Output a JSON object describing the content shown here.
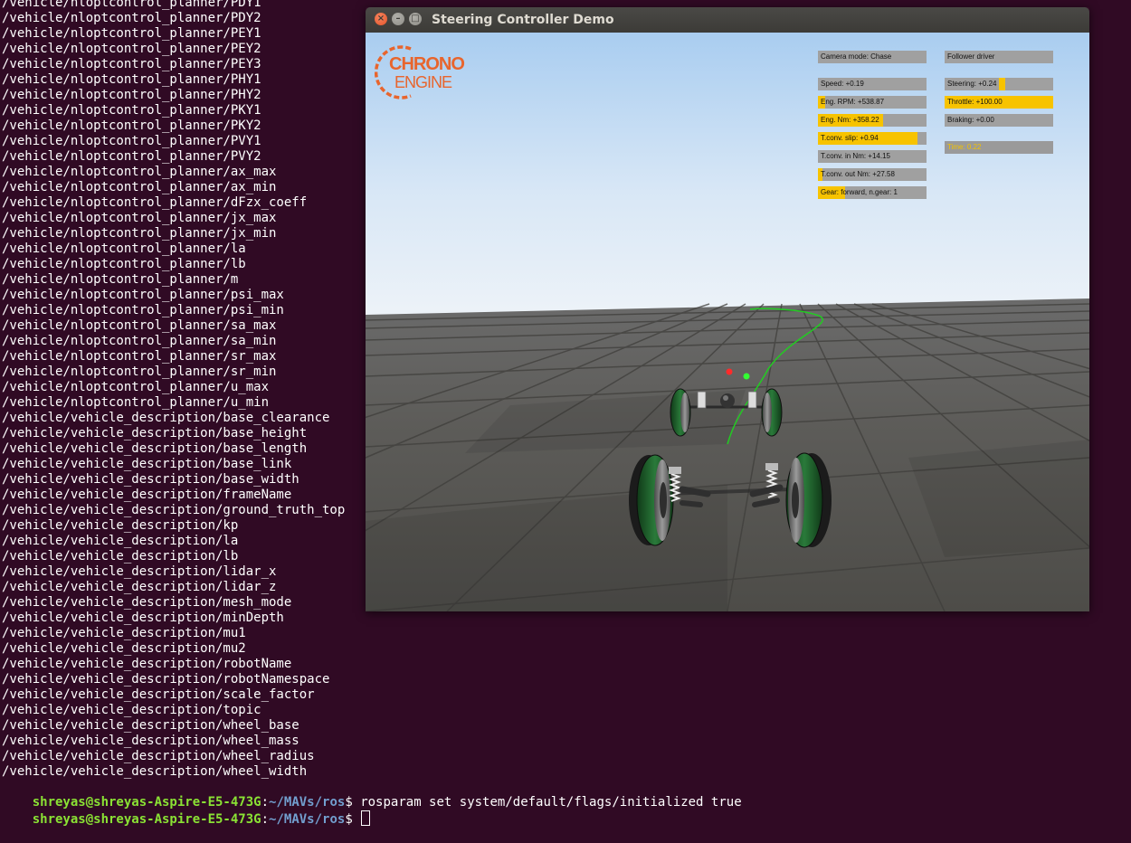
{
  "terminal": {
    "lines": [
      "/vehicle/nloptcontrol_planner/PDY1",
      "/vehicle/nloptcontrol_planner/PDY2",
      "/vehicle/nloptcontrol_planner/PEY1",
      "/vehicle/nloptcontrol_planner/PEY2",
      "/vehicle/nloptcontrol_planner/PEY3",
      "/vehicle/nloptcontrol_planner/PHY1",
      "/vehicle/nloptcontrol_planner/PHY2",
      "/vehicle/nloptcontrol_planner/PKY1",
      "/vehicle/nloptcontrol_planner/PKY2",
      "/vehicle/nloptcontrol_planner/PVY1",
      "/vehicle/nloptcontrol_planner/PVY2",
      "/vehicle/nloptcontrol_planner/ax_max",
      "/vehicle/nloptcontrol_planner/ax_min",
      "/vehicle/nloptcontrol_planner/dFzx_coeff",
      "/vehicle/nloptcontrol_planner/jx_max",
      "/vehicle/nloptcontrol_planner/jx_min",
      "/vehicle/nloptcontrol_planner/la",
      "/vehicle/nloptcontrol_planner/lb",
      "/vehicle/nloptcontrol_planner/m",
      "/vehicle/nloptcontrol_planner/psi_max",
      "/vehicle/nloptcontrol_planner/psi_min",
      "/vehicle/nloptcontrol_planner/sa_max",
      "/vehicle/nloptcontrol_planner/sa_min",
      "/vehicle/nloptcontrol_planner/sr_max",
      "/vehicle/nloptcontrol_planner/sr_min",
      "/vehicle/nloptcontrol_planner/u_max",
      "/vehicle/nloptcontrol_planner/u_min",
      "/vehicle/vehicle_description/base_clearance",
      "/vehicle/vehicle_description/base_height",
      "/vehicle/vehicle_description/base_length",
      "/vehicle/vehicle_description/base_link",
      "/vehicle/vehicle_description/base_width",
      "/vehicle/vehicle_description/frameName",
      "/vehicle/vehicle_description/ground_truth_top",
      "/vehicle/vehicle_description/kp",
      "/vehicle/vehicle_description/la",
      "/vehicle/vehicle_description/lb",
      "/vehicle/vehicle_description/lidar_x",
      "/vehicle/vehicle_description/lidar_z",
      "/vehicle/vehicle_description/mesh_mode",
      "/vehicle/vehicle_description/minDepth",
      "/vehicle/vehicle_description/mu1",
      "/vehicle/vehicle_description/mu2",
      "/vehicle/vehicle_description/robotName",
      "/vehicle/vehicle_description/robotNamespace",
      "/vehicle/vehicle_description/scale_factor",
      "/vehicle/vehicle_description/topic",
      "/vehicle/vehicle_description/wheel_base",
      "/vehicle/vehicle_description/wheel_mass",
      "/vehicle/vehicle_description/wheel_radius",
      "/vehicle/vehicle_description/wheel_width"
    ],
    "prompt_user": "shreyas@shreyas-Aspire-E5-473G",
    "prompt_path": "~/MAVs/ros",
    "prompt_symbol": "$ ",
    "last_command": "rosparam set system/default/flags/initialized true",
    "current_input": ""
  },
  "window": {
    "title": "Steering Controller Demo",
    "close_glyph": "×",
    "minimize_glyph": "–",
    "maximize_glyph": "□"
  },
  "logo": {
    "line1": "CHRONO",
    "line2": "ENGINE",
    "color": "#e8652d"
  },
  "hud": {
    "camera_mode": {
      "label": "Camera mode: Chase"
    },
    "driver": {
      "label": "Follower driver"
    },
    "speed": {
      "label": "Speed: +0.19",
      "level": 0.0
    },
    "eng_rpm": {
      "label": "Eng. RPM: +538.87",
      "level": 0.07
    },
    "eng_nm": {
      "label": "Eng. Nm: +358.22",
      "level": 0.6
    },
    "tconv_slip": {
      "label": "T.conv. slip: +0.94",
      "level": 0.92
    },
    "tconv_in": {
      "label": "T.conv. in  Nm: +14.15",
      "level": 0.0
    },
    "tconv_out": {
      "label": "T.conv. out Nm: +27.58",
      "level": 0.04
    },
    "gear": {
      "label": "Gear: forward, n.gear: 1",
      "level": 0.25
    },
    "steering": {
      "label": "Steering: +0.24",
      "level": 0.12
    },
    "throttle": {
      "label": "Throttle: +100.00",
      "level": 1.0
    },
    "braking": {
      "label": "Braking: +0.00",
      "level": 0.0
    },
    "time": {
      "label": "Time: 0.22"
    },
    "fill_color": "#f7c300",
    "bg_color": "#a0a0a0"
  },
  "colors": {
    "terminal_bg": "#300a24",
    "prompt_user": "#8ae234",
    "prompt_path": "#729fcf",
    "path_line": "#22cc22",
    "wheel_tread": "#1e5a2a"
  }
}
